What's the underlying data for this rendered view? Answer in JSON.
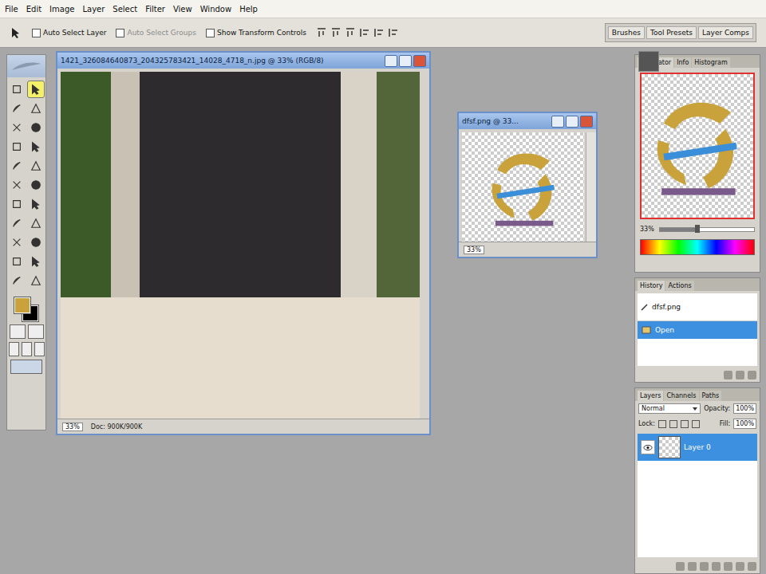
{
  "menu": [
    "File",
    "Edit",
    "Image",
    "Layer",
    "Select",
    "Filter",
    "View",
    "Window",
    "Help"
  ],
  "options_bar": {
    "auto_select": {
      "label": "Auto Select Layer",
      "checked": false
    },
    "auto_groups": {
      "label": "Auto Select Groups",
      "checked": false,
      "disabled": true
    },
    "show_transform": {
      "label": "Show Transform Controls",
      "checked": false
    },
    "palette_tabs": [
      "Brushes",
      "Tool Presets",
      "Layer Comps"
    ]
  },
  "tools": [
    {
      "selected": false
    },
    {
      "selected": true
    },
    {
      "selected": false
    },
    {
      "selected": false
    },
    {
      "selected": false
    },
    {
      "selected": false
    },
    {
      "selected": false
    },
    {
      "selected": false
    },
    {
      "selected": false
    },
    {
      "selected": false
    },
    {
      "selected": false
    },
    {
      "selected": false
    },
    {
      "selected": false
    },
    {
      "selected": false
    },
    {
      "selected": false
    },
    {
      "selected": false
    },
    {
      "selected": false
    },
    {
      "selected": false
    },
    {
      "selected": false
    },
    {
      "selected": false
    },
    {
      "selected": false
    },
    {
      "selected": false
    }
  ],
  "swatches": {
    "foreground": "#c9a23c",
    "background": "#000000"
  },
  "document": {
    "title": "1421_326084640873_204325783421_14028_4718_n.jpg @ 33% (RGB/8)",
    "zoom": "33%",
    "status": "Doc: 900K/900K"
  },
  "logo_window": {
    "title": "dfsf.png @ 33...",
    "zoom": "33%"
  },
  "navigator": {
    "tabs": [
      {
        "label": "Navigator",
        "selected": true
      },
      {
        "label": "Info",
        "selected": false
      },
      {
        "label": "Histogram",
        "selected": false
      }
    ],
    "zoom": "33%",
    "level": 0.4
  },
  "history": {
    "tabs": [
      {
        "label": "History",
        "selected": true
      },
      {
        "label": "Actions",
        "selected": false
      }
    ],
    "items": [
      {
        "label": "dfsf.png",
        "kind": "snapshot",
        "selected": false
      },
      {
        "label": "Open",
        "kind": "step",
        "selected": true
      }
    ]
  },
  "layers": {
    "tabs": [
      {
        "label": "Layers",
        "selected": true
      },
      {
        "label": "Channels",
        "selected": false
      },
      {
        "label": "Paths",
        "selected": false
      }
    ],
    "blend_mode": "Normal",
    "opacity_label": "Opacity:",
    "opacity": "100%",
    "lock_label": "Lock:",
    "fill_label": "Fill:",
    "fill": "100%",
    "items": [
      {
        "label": "Layer 0",
        "visible": true,
        "selected": true
      }
    ]
  }
}
